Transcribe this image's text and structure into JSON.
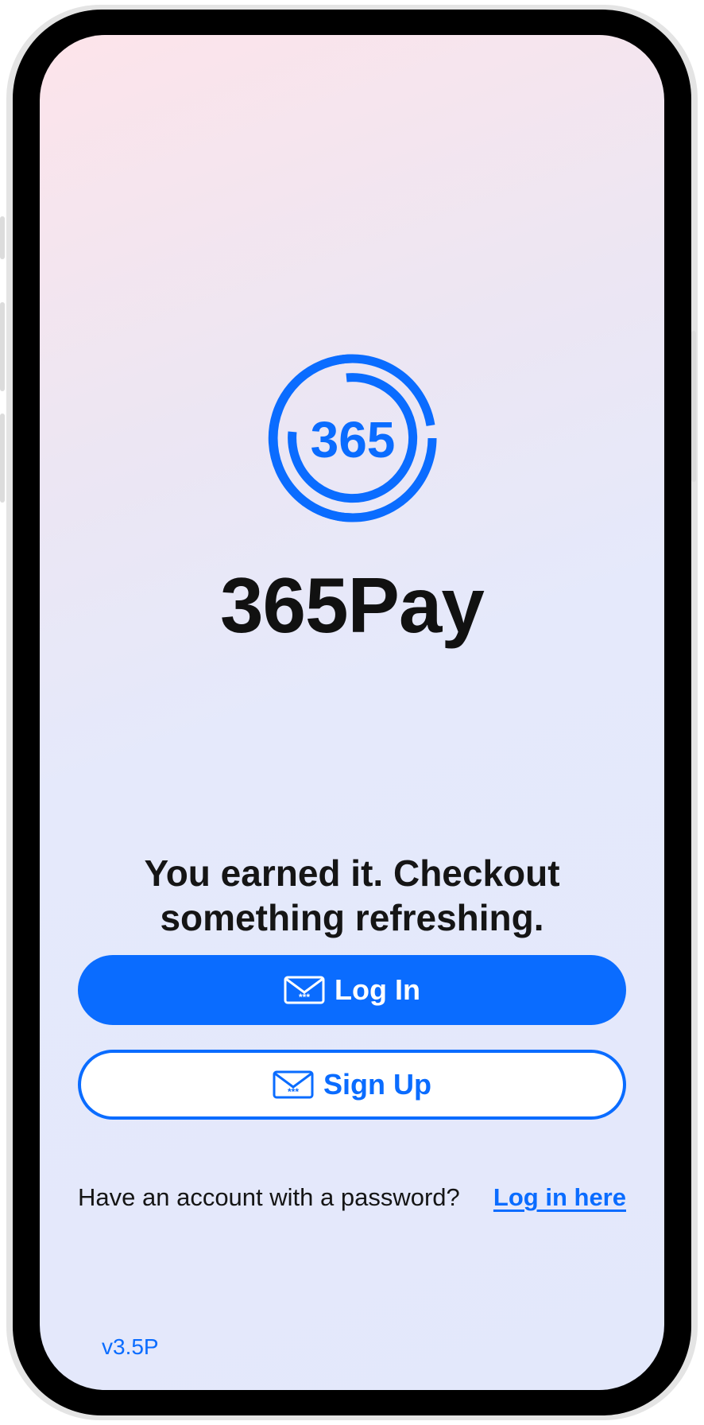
{
  "app": {
    "name": "365Pay",
    "logo_text": "365"
  },
  "main": {
    "tagline_line1": "You earned it. Checkout",
    "tagline_line2": "something refreshing.",
    "login_button": "Log In",
    "signup_button": "Sign Up",
    "password_prompt": "Have an account with a password?",
    "password_link": "Log in here"
  },
  "footer": {
    "version": "v3.5P"
  },
  "icons": {
    "login_button_icon": "envelope-password-icon",
    "signup_button_icon": "envelope-password-icon"
  },
  "colors": {
    "accent": "#0a6cff",
    "text": "#151515"
  }
}
